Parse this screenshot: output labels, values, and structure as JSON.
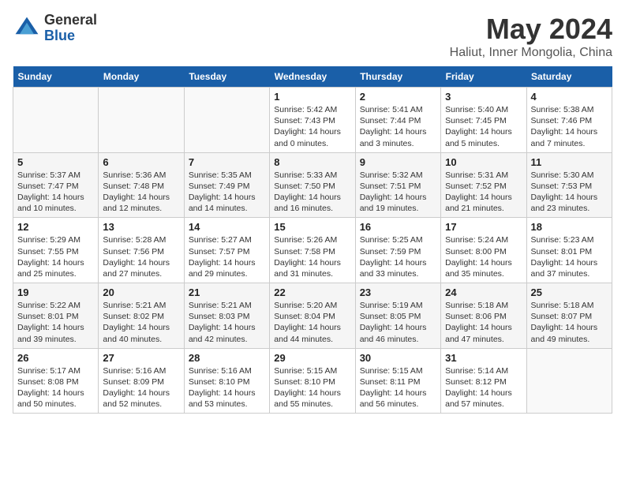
{
  "logo": {
    "general": "General",
    "blue": "Blue"
  },
  "title": "May 2024",
  "subtitle": "Haliut, Inner Mongolia, China",
  "days_of_week": [
    "Sunday",
    "Monday",
    "Tuesday",
    "Wednesday",
    "Thursday",
    "Friday",
    "Saturday"
  ],
  "weeks": [
    [
      {
        "num": "",
        "sunrise": "",
        "sunset": "",
        "daylight": ""
      },
      {
        "num": "",
        "sunrise": "",
        "sunset": "",
        "daylight": ""
      },
      {
        "num": "",
        "sunrise": "",
        "sunset": "",
        "daylight": ""
      },
      {
        "num": "1",
        "sunrise": "Sunrise: 5:42 AM",
        "sunset": "Sunset: 7:43 PM",
        "daylight": "Daylight: 14 hours and 0 minutes."
      },
      {
        "num": "2",
        "sunrise": "Sunrise: 5:41 AM",
        "sunset": "Sunset: 7:44 PM",
        "daylight": "Daylight: 14 hours and 3 minutes."
      },
      {
        "num": "3",
        "sunrise": "Sunrise: 5:40 AM",
        "sunset": "Sunset: 7:45 PM",
        "daylight": "Daylight: 14 hours and 5 minutes."
      },
      {
        "num": "4",
        "sunrise": "Sunrise: 5:38 AM",
        "sunset": "Sunset: 7:46 PM",
        "daylight": "Daylight: 14 hours and 7 minutes."
      }
    ],
    [
      {
        "num": "5",
        "sunrise": "Sunrise: 5:37 AM",
        "sunset": "Sunset: 7:47 PM",
        "daylight": "Daylight: 14 hours and 10 minutes."
      },
      {
        "num": "6",
        "sunrise": "Sunrise: 5:36 AM",
        "sunset": "Sunset: 7:48 PM",
        "daylight": "Daylight: 14 hours and 12 minutes."
      },
      {
        "num": "7",
        "sunrise": "Sunrise: 5:35 AM",
        "sunset": "Sunset: 7:49 PM",
        "daylight": "Daylight: 14 hours and 14 minutes."
      },
      {
        "num": "8",
        "sunrise": "Sunrise: 5:33 AM",
        "sunset": "Sunset: 7:50 PM",
        "daylight": "Daylight: 14 hours and 16 minutes."
      },
      {
        "num": "9",
        "sunrise": "Sunrise: 5:32 AM",
        "sunset": "Sunset: 7:51 PM",
        "daylight": "Daylight: 14 hours and 19 minutes."
      },
      {
        "num": "10",
        "sunrise": "Sunrise: 5:31 AM",
        "sunset": "Sunset: 7:52 PM",
        "daylight": "Daylight: 14 hours and 21 minutes."
      },
      {
        "num": "11",
        "sunrise": "Sunrise: 5:30 AM",
        "sunset": "Sunset: 7:53 PM",
        "daylight": "Daylight: 14 hours and 23 minutes."
      }
    ],
    [
      {
        "num": "12",
        "sunrise": "Sunrise: 5:29 AM",
        "sunset": "Sunset: 7:55 PM",
        "daylight": "Daylight: 14 hours and 25 minutes."
      },
      {
        "num": "13",
        "sunrise": "Sunrise: 5:28 AM",
        "sunset": "Sunset: 7:56 PM",
        "daylight": "Daylight: 14 hours and 27 minutes."
      },
      {
        "num": "14",
        "sunrise": "Sunrise: 5:27 AM",
        "sunset": "Sunset: 7:57 PM",
        "daylight": "Daylight: 14 hours and 29 minutes."
      },
      {
        "num": "15",
        "sunrise": "Sunrise: 5:26 AM",
        "sunset": "Sunset: 7:58 PM",
        "daylight": "Daylight: 14 hours and 31 minutes."
      },
      {
        "num": "16",
        "sunrise": "Sunrise: 5:25 AM",
        "sunset": "Sunset: 7:59 PM",
        "daylight": "Daylight: 14 hours and 33 minutes."
      },
      {
        "num": "17",
        "sunrise": "Sunrise: 5:24 AM",
        "sunset": "Sunset: 8:00 PM",
        "daylight": "Daylight: 14 hours and 35 minutes."
      },
      {
        "num": "18",
        "sunrise": "Sunrise: 5:23 AM",
        "sunset": "Sunset: 8:01 PM",
        "daylight": "Daylight: 14 hours and 37 minutes."
      }
    ],
    [
      {
        "num": "19",
        "sunrise": "Sunrise: 5:22 AM",
        "sunset": "Sunset: 8:01 PM",
        "daylight": "Daylight: 14 hours and 39 minutes."
      },
      {
        "num": "20",
        "sunrise": "Sunrise: 5:21 AM",
        "sunset": "Sunset: 8:02 PM",
        "daylight": "Daylight: 14 hours and 40 minutes."
      },
      {
        "num": "21",
        "sunrise": "Sunrise: 5:21 AM",
        "sunset": "Sunset: 8:03 PM",
        "daylight": "Daylight: 14 hours and 42 minutes."
      },
      {
        "num": "22",
        "sunrise": "Sunrise: 5:20 AM",
        "sunset": "Sunset: 8:04 PM",
        "daylight": "Daylight: 14 hours and 44 minutes."
      },
      {
        "num": "23",
        "sunrise": "Sunrise: 5:19 AM",
        "sunset": "Sunset: 8:05 PM",
        "daylight": "Daylight: 14 hours and 46 minutes."
      },
      {
        "num": "24",
        "sunrise": "Sunrise: 5:18 AM",
        "sunset": "Sunset: 8:06 PM",
        "daylight": "Daylight: 14 hours and 47 minutes."
      },
      {
        "num": "25",
        "sunrise": "Sunrise: 5:18 AM",
        "sunset": "Sunset: 8:07 PM",
        "daylight": "Daylight: 14 hours and 49 minutes."
      }
    ],
    [
      {
        "num": "26",
        "sunrise": "Sunrise: 5:17 AM",
        "sunset": "Sunset: 8:08 PM",
        "daylight": "Daylight: 14 hours and 50 minutes."
      },
      {
        "num": "27",
        "sunrise": "Sunrise: 5:16 AM",
        "sunset": "Sunset: 8:09 PM",
        "daylight": "Daylight: 14 hours and 52 minutes."
      },
      {
        "num": "28",
        "sunrise": "Sunrise: 5:16 AM",
        "sunset": "Sunset: 8:10 PM",
        "daylight": "Daylight: 14 hours and 53 minutes."
      },
      {
        "num": "29",
        "sunrise": "Sunrise: 5:15 AM",
        "sunset": "Sunset: 8:10 PM",
        "daylight": "Daylight: 14 hours and 55 minutes."
      },
      {
        "num": "30",
        "sunrise": "Sunrise: 5:15 AM",
        "sunset": "Sunset: 8:11 PM",
        "daylight": "Daylight: 14 hours and 56 minutes."
      },
      {
        "num": "31",
        "sunrise": "Sunrise: 5:14 AM",
        "sunset": "Sunset: 8:12 PM",
        "daylight": "Daylight: 14 hours and 57 minutes."
      },
      {
        "num": "",
        "sunrise": "",
        "sunset": "",
        "daylight": ""
      }
    ]
  ]
}
